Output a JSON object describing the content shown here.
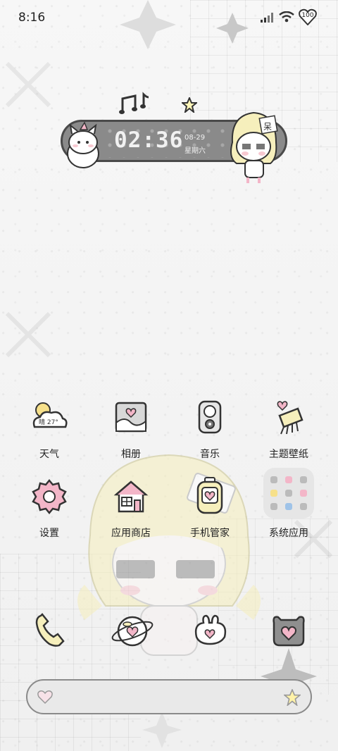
{
  "status_bar": {
    "time": "8:16",
    "battery": "100",
    "icons": [
      "signal-icon",
      "wifi-icon",
      "battery-heart-icon"
    ]
  },
  "clock_widget": {
    "time": "02:36",
    "date": "08-29",
    "weekday": "星期六",
    "name_tag": "呆"
  },
  "apps": [
    {
      "label": "天气",
      "icon": "weather-icon",
      "temp": "晴 27°"
    },
    {
      "label": "相册",
      "icon": "gallery-icon"
    },
    {
      "label": "音乐",
      "icon": "music-icon"
    },
    {
      "label": "主题壁纸",
      "icon": "theme-icon"
    },
    {
      "label": "设置",
      "icon": "settings-icon"
    },
    {
      "label": "应用商店",
      "icon": "app-store-icon"
    },
    {
      "label": "手机管家",
      "icon": "phone-manager-icon"
    },
    {
      "label": "系统应用",
      "icon": "system-apps-folder"
    }
  ],
  "dock": [
    {
      "icon": "phone-icon"
    },
    {
      "icon": "browser-icon"
    },
    {
      "icon": "messages-icon"
    },
    {
      "icon": "camera-icon"
    }
  ],
  "search_bar": {
    "left_icon": "heart-icon",
    "right_icon": "star-icon"
  },
  "colors": {
    "pink": "#f3b6c8",
    "yellow": "#f6f0bf",
    "gray": "#8a8a8a",
    "dark": "#4a4a4a"
  }
}
